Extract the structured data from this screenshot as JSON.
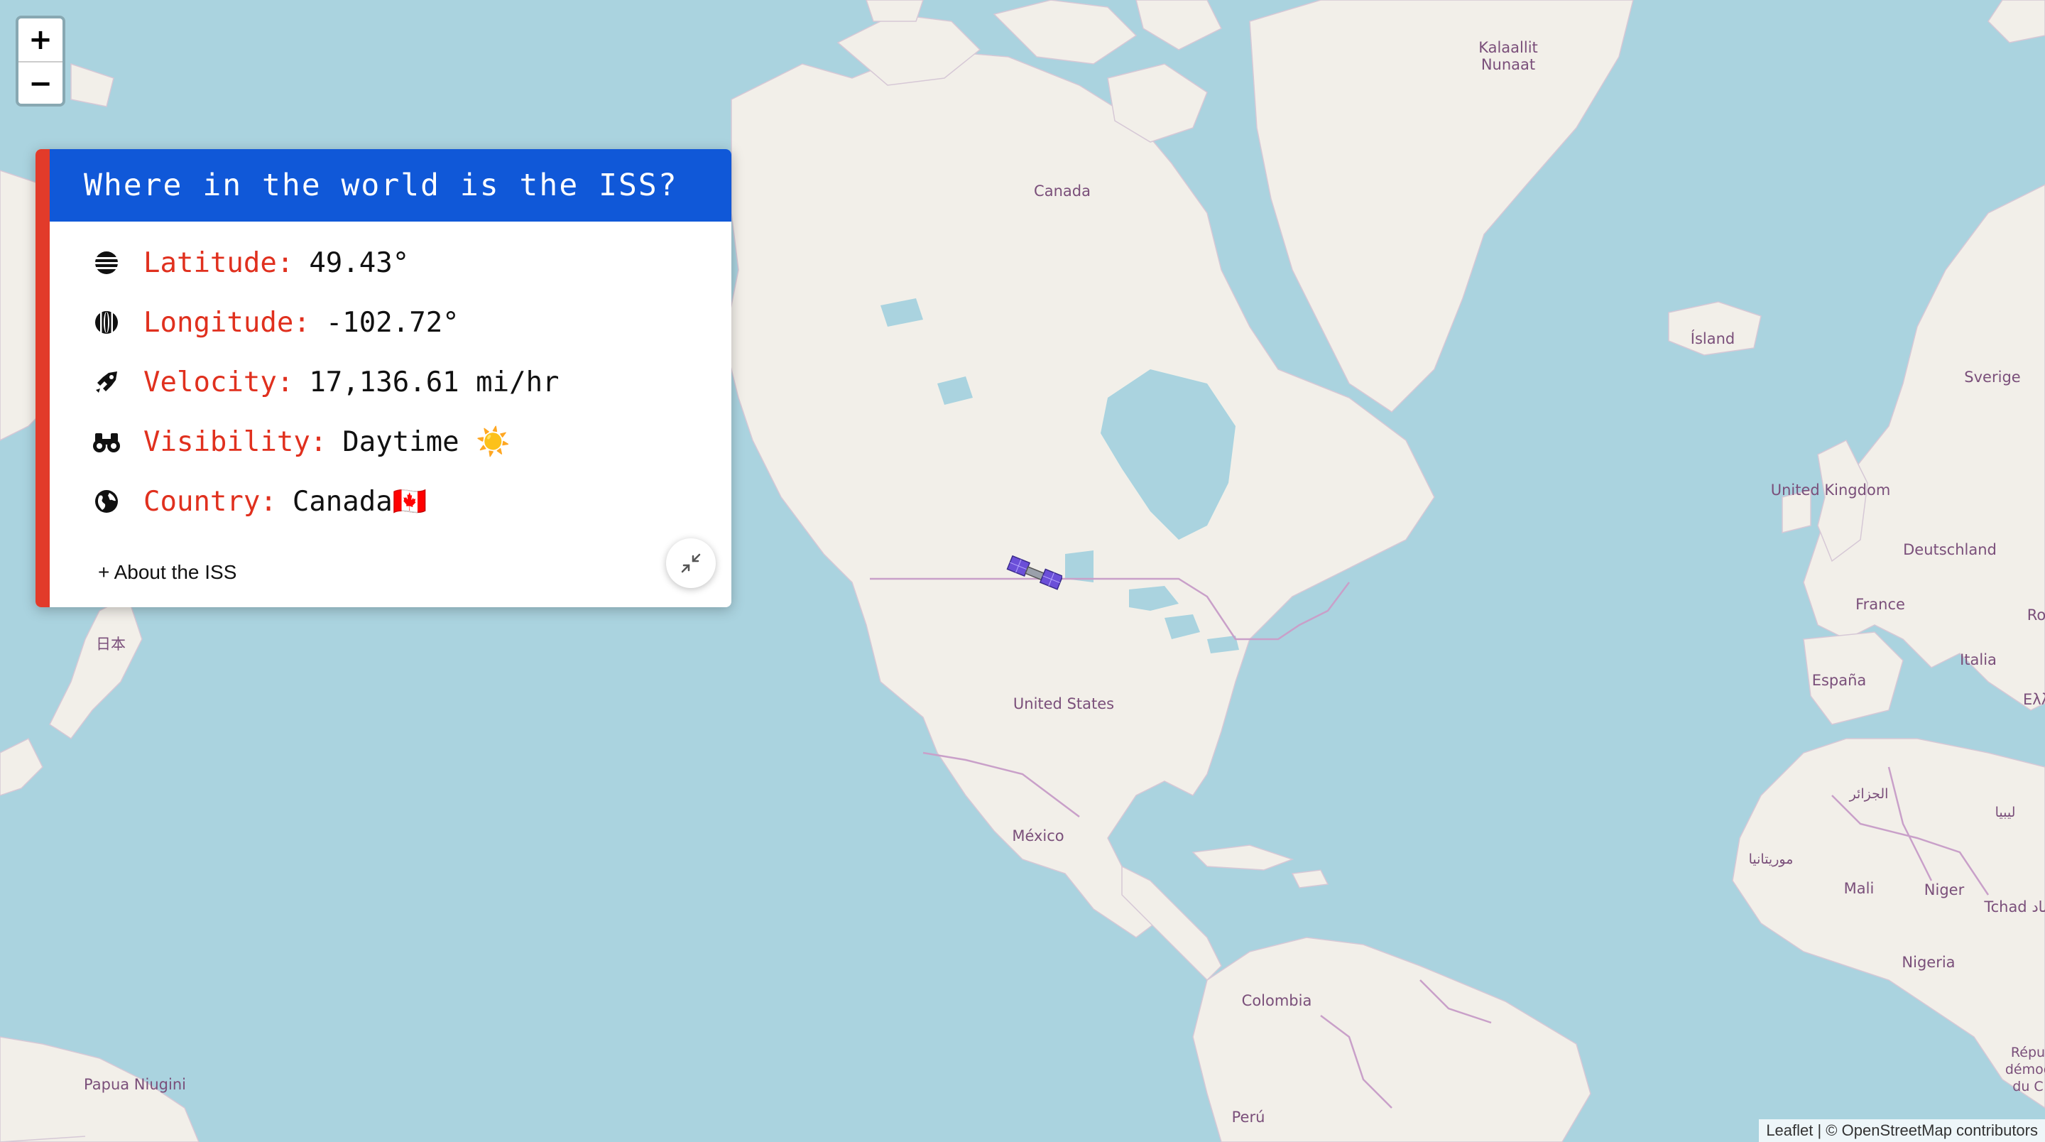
{
  "map": {
    "labels": {
      "greenland": "Kalaallit\nNunaat",
      "canada": "Canada",
      "iceland": "Ísland",
      "sweden": "Sverige",
      "uk": "United Kingdom",
      "germany": "Deutschland",
      "france": "France",
      "spain": "España",
      "italy": "Italia",
      "ro": "Ro",
      "greece": "Ελλ",
      "usa": "United States",
      "mexico": "México",
      "colombia": "Colombia",
      "peru": "Perú",
      "png": "Papua Niugini",
      "japan": "日本",
      "algeria": "الجزائر",
      "libya": "ليبيا",
      "mauritania": "موريتانيا",
      "mali": "Mali",
      "niger": "Niger",
      "chad": "Tchad تشاد",
      "nigeria": "Nigeria",
      "drc": "Répu\ndémoc\ndu C"
    },
    "colors": {
      "water": "#aad3df",
      "land": "#f2efe9",
      "border": "#c9a0c9"
    }
  },
  "zoom": {
    "in_label": "+",
    "out_label": "−"
  },
  "panel": {
    "title": "Where in the world is the ISS?",
    "rows": [
      {
        "icon": "globe-lines-icon",
        "label": "Latitude:",
        "value": "49.43°"
      },
      {
        "icon": "meridian-icon",
        "label": "Longitude:",
        "value": "-102.72°"
      },
      {
        "icon": "rocket-icon",
        "label": "Velocity:",
        "value": "17,136.61 mi/hr"
      },
      {
        "icon": "binoculars-icon",
        "label": "Visibility:",
        "value": "Daytime ☀️"
      },
      {
        "icon": "globe-icon",
        "label": "Country:",
        "value": "Canada🇨🇦"
      }
    ],
    "about_label": "+ About the ISS",
    "colors": {
      "header": "#1058d8",
      "accent": "#e23b2a",
      "label": "#e0301e"
    }
  },
  "marker": {
    "icon": "iss-satellite-icon"
  },
  "attribution": "Leaflet | © OpenStreetMap contributors"
}
